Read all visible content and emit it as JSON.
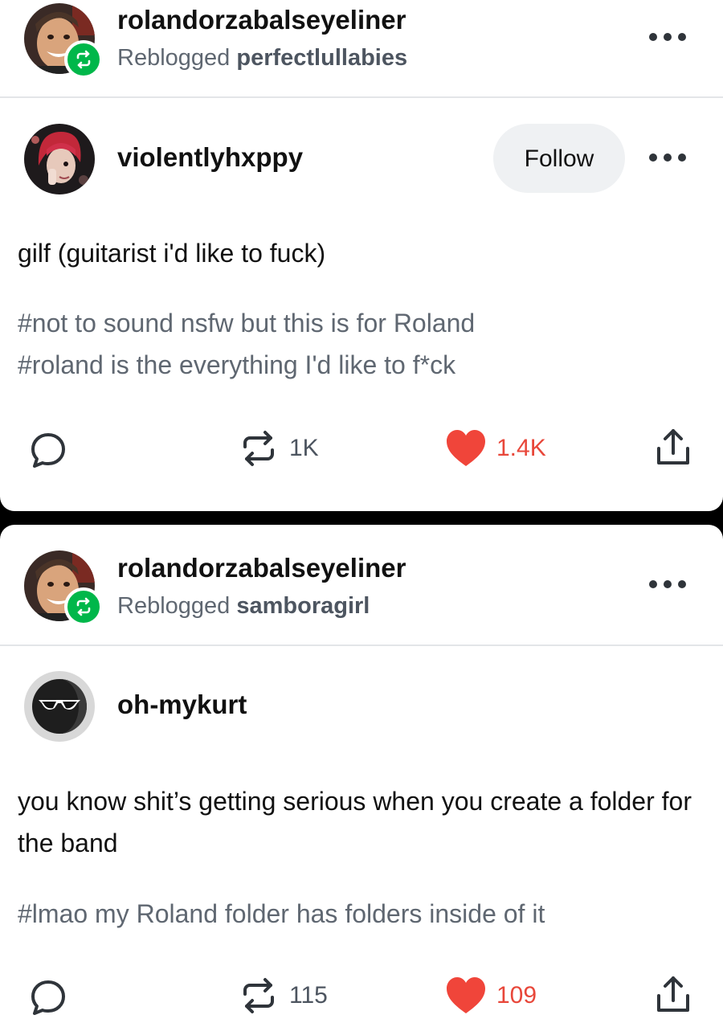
{
  "posts": [
    {
      "reblogger": "rolandorzabalseyeliner",
      "reblogged_prefix": "Reblogged",
      "reblogged_from": "perfectlullabies",
      "author": "violentlyhxppy",
      "follow_label": "Follow",
      "body": "gilf (guitarist i'd like to fuck)",
      "tags": [
        "#not to sound nsfw but this is for Roland",
        "#roland is the everything I'd like to f*ck"
      ],
      "reblog_count": "1K",
      "like_count": "1.4K"
    },
    {
      "reblogger": "rolandorzabalseyeliner",
      "reblogged_prefix": "Reblogged",
      "reblogged_from": "samboragirl",
      "author": "oh-mykurt",
      "body": "you know shit’s getting serious when you create a folder for the band",
      "tags": [
        "#lmao my Roland folder has folders inside of it"
      ],
      "reblog_count": "115",
      "like_count": "109"
    }
  ],
  "colors": {
    "reblog_badge": "#00b74a",
    "like": "#f0453a",
    "tag_text": "#5f6771",
    "follow_bg": "#eff1f3"
  },
  "icons": [
    "reblog-badge-icon",
    "more-icon",
    "comment-icon",
    "reblog-icon",
    "heart-icon",
    "share-icon"
  ]
}
